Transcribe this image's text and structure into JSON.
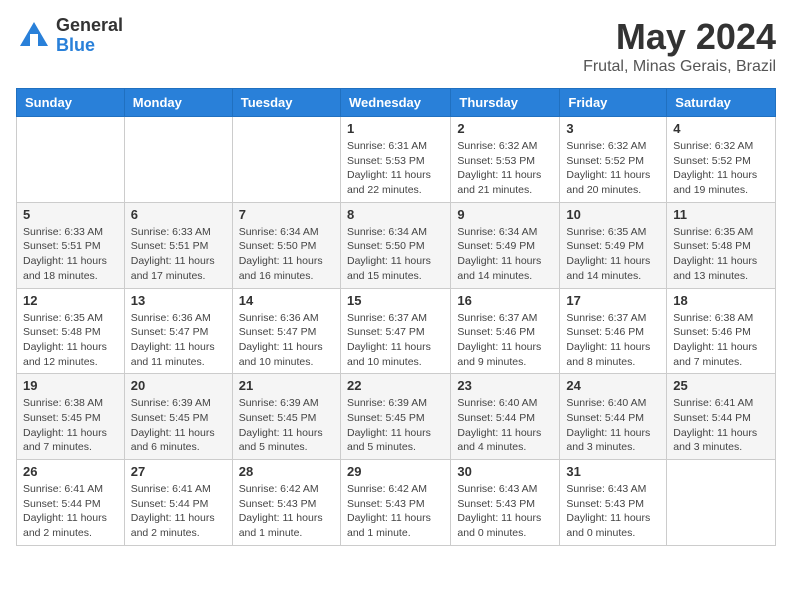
{
  "header": {
    "logo_general": "General",
    "logo_blue": "Blue",
    "title": "May 2024",
    "location": "Frutal, Minas Gerais, Brazil"
  },
  "weekdays": [
    "Sunday",
    "Monday",
    "Tuesday",
    "Wednesday",
    "Thursday",
    "Friday",
    "Saturday"
  ],
  "weeks": [
    [
      {
        "day": "",
        "sunrise": "",
        "sunset": "",
        "daylight": ""
      },
      {
        "day": "",
        "sunrise": "",
        "sunset": "",
        "daylight": ""
      },
      {
        "day": "",
        "sunrise": "",
        "sunset": "",
        "daylight": ""
      },
      {
        "day": "1",
        "sunrise": "Sunrise: 6:31 AM",
        "sunset": "Sunset: 5:53 PM",
        "daylight": "Daylight: 11 hours and 22 minutes."
      },
      {
        "day": "2",
        "sunrise": "Sunrise: 6:32 AM",
        "sunset": "Sunset: 5:53 PM",
        "daylight": "Daylight: 11 hours and 21 minutes."
      },
      {
        "day": "3",
        "sunrise": "Sunrise: 6:32 AM",
        "sunset": "Sunset: 5:52 PM",
        "daylight": "Daylight: 11 hours and 20 minutes."
      },
      {
        "day": "4",
        "sunrise": "Sunrise: 6:32 AM",
        "sunset": "Sunset: 5:52 PM",
        "daylight": "Daylight: 11 hours and 19 minutes."
      }
    ],
    [
      {
        "day": "5",
        "sunrise": "Sunrise: 6:33 AM",
        "sunset": "Sunset: 5:51 PM",
        "daylight": "Daylight: 11 hours and 18 minutes."
      },
      {
        "day": "6",
        "sunrise": "Sunrise: 6:33 AM",
        "sunset": "Sunset: 5:51 PM",
        "daylight": "Daylight: 11 hours and 17 minutes."
      },
      {
        "day": "7",
        "sunrise": "Sunrise: 6:34 AM",
        "sunset": "Sunset: 5:50 PM",
        "daylight": "Daylight: 11 hours and 16 minutes."
      },
      {
        "day": "8",
        "sunrise": "Sunrise: 6:34 AM",
        "sunset": "Sunset: 5:50 PM",
        "daylight": "Daylight: 11 hours and 15 minutes."
      },
      {
        "day": "9",
        "sunrise": "Sunrise: 6:34 AM",
        "sunset": "Sunset: 5:49 PM",
        "daylight": "Daylight: 11 hours and 14 minutes."
      },
      {
        "day": "10",
        "sunrise": "Sunrise: 6:35 AM",
        "sunset": "Sunset: 5:49 PM",
        "daylight": "Daylight: 11 hours and 14 minutes."
      },
      {
        "day": "11",
        "sunrise": "Sunrise: 6:35 AM",
        "sunset": "Sunset: 5:48 PM",
        "daylight": "Daylight: 11 hours and 13 minutes."
      }
    ],
    [
      {
        "day": "12",
        "sunrise": "Sunrise: 6:35 AM",
        "sunset": "Sunset: 5:48 PM",
        "daylight": "Daylight: 11 hours and 12 minutes."
      },
      {
        "day": "13",
        "sunrise": "Sunrise: 6:36 AM",
        "sunset": "Sunset: 5:47 PM",
        "daylight": "Daylight: 11 hours and 11 minutes."
      },
      {
        "day": "14",
        "sunrise": "Sunrise: 6:36 AM",
        "sunset": "Sunset: 5:47 PM",
        "daylight": "Daylight: 11 hours and 10 minutes."
      },
      {
        "day": "15",
        "sunrise": "Sunrise: 6:37 AM",
        "sunset": "Sunset: 5:47 PM",
        "daylight": "Daylight: 11 hours and 10 minutes."
      },
      {
        "day": "16",
        "sunrise": "Sunrise: 6:37 AM",
        "sunset": "Sunset: 5:46 PM",
        "daylight": "Daylight: 11 hours and 9 minutes."
      },
      {
        "day": "17",
        "sunrise": "Sunrise: 6:37 AM",
        "sunset": "Sunset: 5:46 PM",
        "daylight": "Daylight: 11 hours and 8 minutes."
      },
      {
        "day": "18",
        "sunrise": "Sunrise: 6:38 AM",
        "sunset": "Sunset: 5:46 PM",
        "daylight": "Daylight: 11 hours and 7 minutes."
      }
    ],
    [
      {
        "day": "19",
        "sunrise": "Sunrise: 6:38 AM",
        "sunset": "Sunset: 5:45 PM",
        "daylight": "Daylight: 11 hours and 7 minutes."
      },
      {
        "day": "20",
        "sunrise": "Sunrise: 6:39 AM",
        "sunset": "Sunset: 5:45 PM",
        "daylight": "Daylight: 11 hours and 6 minutes."
      },
      {
        "day": "21",
        "sunrise": "Sunrise: 6:39 AM",
        "sunset": "Sunset: 5:45 PM",
        "daylight": "Daylight: 11 hours and 5 minutes."
      },
      {
        "day": "22",
        "sunrise": "Sunrise: 6:39 AM",
        "sunset": "Sunset: 5:45 PM",
        "daylight": "Daylight: 11 hours and 5 minutes."
      },
      {
        "day": "23",
        "sunrise": "Sunrise: 6:40 AM",
        "sunset": "Sunset: 5:44 PM",
        "daylight": "Daylight: 11 hours and 4 minutes."
      },
      {
        "day": "24",
        "sunrise": "Sunrise: 6:40 AM",
        "sunset": "Sunset: 5:44 PM",
        "daylight": "Daylight: 11 hours and 3 minutes."
      },
      {
        "day": "25",
        "sunrise": "Sunrise: 6:41 AM",
        "sunset": "Sunset: 5:44 PM",
        "daylight": "Daylight: 11 hours and 3 minutes."
      }
    ],
    [
      {
        "day": "26",
        "sunrise": "Sunrise: 6:41 AM",
        "sunset": "Sunset: 5:44 PM",
        "daylight": "Daylight: 11 hours and 2 minutes."
      },
      {
        "day": "27",
        "sunrise": "Sunrise: 6:41 AM",
        "sunset": "Sunset: 5:44 PM",
        "daylight": "Daylight: 11 hours and 2 minutes."
      },
      {
        "day": "28",
        "sunrise": "Sunrise: 6:42 AM",
        "sunset": "Sunset: 5:43 PM",
        "daylight": "Daylight: 11 hours and 1 minute."
      },
      {
        "day": "29",
        "sunrise": "Sunrise: 6:42 AM",
        "sunset": "Sunset: 5:43 PM",
        "daylight": "Daylight: 11 hours and 1 minute."
      },
      {
        "day": "30",
        "sunrise": "Sunrise: 6:43 AM",
        "sunset": "Sunset: 5:43 PM",
        "daylight": "Daylight: 11 hours and 0 minutes."
      },
      {
        "day": "31",
        "sunrise": "Sunrise: 6:43 AM",
        "sunset": "Sunset: 5:43 PM",
        "daylight": "Daylight: 11 hours and 0 minutes."
      },
      {
        "day": "",
        "sunrise": "",
        "sunset": "",
        "daylight": ""
      }
    ]
  ]
}
